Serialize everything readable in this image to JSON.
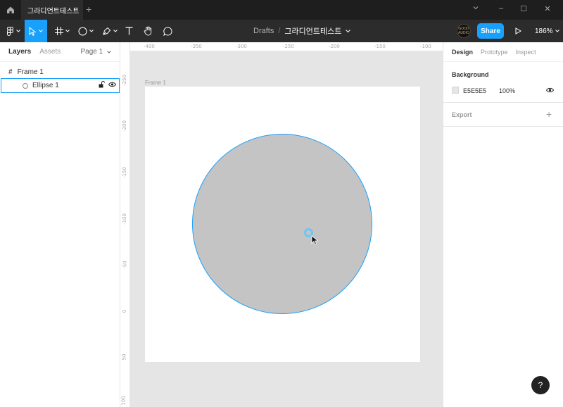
{
  "titlebar": {
    "tab_title": "그라디언트테스트",
    "close_glyph": "×",
    "new_tab_glyph": "+",
    "window_controls": {
      "minimize": "–",
      "maximize": "☐",
      "close": "✕"
    }
  },
  "toolbar": {
    "breadcrumb_drafts": "Drafts",
    "breadcrumb_sep": "/",
    "file_name": "그라디언트테스트",
    "share_label": "Share",
    "zoom_label": "186%",
    "avatar_text": "GOOD AUDIO",
    "tools": [
      "main-menu",
      "move",
      "frame",
      "shape",
      "pen",
      "text",
      "hand",
      "comment"
    ]
  },
  "left_panel": {
    "tab_layers": "Layers",
    "tab_assets": "Assets",
    "page_label": "Page 1",
    "layers": [
      {
        "name": "Frame 1",
        "type": "frame"
      },
      {
        "name": "Ellipse 1",
        "type": "ellipse",
        "selected": true
      }
    ]
  },
  "canvas": {
    "frame_label": "Frame 1",
    "ruler_top": [
      "-400",
      "-350",
      "-300",
      "-250",
      "-200",
      "-150",
      "-100"
    ],
    "ruler_left": [
      "-250",
      "-200",
      "-150",
      "-100",
      "-50",
      "0",
      "50",
      "100"
    ],
    "ellipse_fill": "#C4C4C4",
    "selection_color": "#18A0FB"
  },
  "right_panel": {
    "tab_design": "Design",
    "tab_prototype": "Prototype",
    "tab_inspect": "Inspect",
    "background_title": "Background",
    "background_hex": "E5E5E5",
    "background_opacity": "100%",
    "export_title": "Export",
    "export_add": "+"
  },
  "help_label": "?",
  "colors": {
    "accent": "#18A0FB",
    "toolbar": "#2C2C2C",
    "canvas": "#E5E5E5"
  }
}
